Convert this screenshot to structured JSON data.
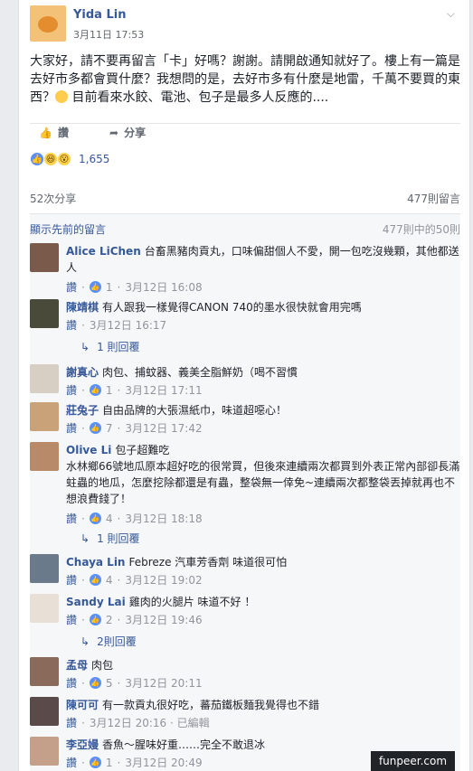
{
  "post": {
    "author": "Yida Lin",
    "timestamp": "3月11日 17:53",
    "body_1": "大家好，請不要再留言「卡」好嗎？謝謝。請開啟通知就好了。樓上有一篇是去好市多都會買什麼？我想問的是，去好市多有什麼是地雷，千萬不要買的東西？",
    "body_2": "目前看來水餃、電池、包子是最多人反應的....",
    "like_label": "讚",
    "share_label": "分享",
    "reaction_count": "1,655",
    "shares": "52次分享",
    "comments": "477則留言"
  },
  "comments_section": {
    "prev_link": "顯示先前的留言",
    "range": "477則中的50則"
  },
  "comments": [
    {
      "name": "Alice LiChen",
      "text": "台畜黑豬肉貢丸，口味偏甜個人不愛，開一包吃沒幾顆，其他都送人",
      "like": "讚",
      "likes": "1",
      "time": "3月12日 16:08"
    },
    {
      "name": "陳靖棋",
      "text": "有人跟我一樣覺得CANON 740的墨水很快就會用完嗎",
      "like": "讚",
      "time": "3月12日 16:17",
      "reply": "1 則回覆"
    },
    {
      "name": "謝真心",
      "text": "肉包、捕蚊器、義美全脂鮮奶（喝不習慣",
      "like": "讚",
      "likes": "1",
      "time": "3月12日 17:11"
    },
    {
      "name": "莊兔子",
      "text": "自由品牌的大張濕紙巾，味道超噁心！",
      "like": "讚",
      "likes": "7",
      "time": "3月12日 17:42"
    },
    {
      "name": "Olive Li",
      "text": "包子超難吃",
      "text_2": "水林鄉66號地瓜原本超好吃的很常買，但後來連續兩次都買到外表正常內部卻長滿蛀蟲的地瓜，怎麼挖除都還是有蟲，整袋無一倖免~連續兩次都整袋丟掉就再也不想浪費錢了！",
      "like": "讚",
      "likes": "4",
      "time": "3月12日 18:18",
      "reply": "1 則回覆"
    },
    {
      "name": "Chaya Lin",
      "text": "Febreze 汽車芳香劑 味道很可怕",
      "like": "讚",
      "likes": "4",
      "time": "3月12日 19:02"
    },
    {
      "name": "Sandy Lai",
      "text": "雞肉的火腿片 味道不好 ！",
      "like": "讚",
      "likes": "2",
      "time": "3月12日 19:46",
      "reply": "2則回覆"
    },
    {
      "name": "孟母",
      "text": "肉包",
      "like": "讚",
      "likes": "5",
      "time": "3月12日 20:11"
    },
    {
      "name": "陳可可",
      "text": "有一款貢丸很好吃，蕃茄鐵板麵我覺得也不錯",
      "like": "讚",
      "time": "3月12日 20:16 · 已編輯"
    },
    {
      "name": "李亞嫚",
      "text": "香魚～腥味好重……完全不敢退冰",
      "like": "讚",
      "likes": "1",
      "time": "3月12日 20:49"
    }
  ],
  "watermark": "funpeer.com"
}
